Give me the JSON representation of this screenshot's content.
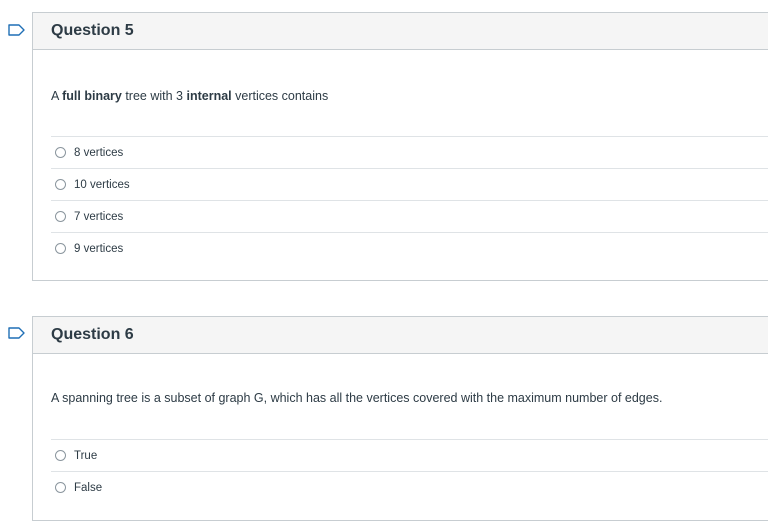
{
  "question5": {
    "title": "Question 5",
    "text_parts": [
      "A ",
      "full binary",
      " tree with 3 ",
      "internal",
      " vertices contains"
    ],
    "answers": [
      "8 vertices",
      "10 vertices",
      "7 vertices",
      "9 vertices"
    ]
  },
  "question6": {
    "title": "Question 6",
    "text": "A spanning tree is a subset of graph G, which has all the vertices covered with the maximum number of edges.",
    "answers": [
      "True",
      "False"
    ]
  },
  "colors": {
    "flag": "#1f6fb5",
    "border": "#c7cdd1",
    "header_bg": "#f5f5f5",
    "text": "#2d3b45"
  }
}
